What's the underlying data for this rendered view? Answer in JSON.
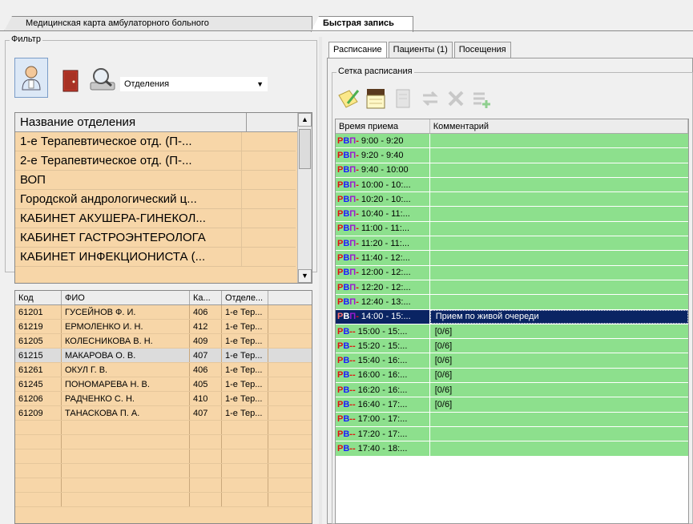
{
  "top_tabs": [
    {
      "label": "Медицинская карта амбулаторного больного"
    },
    {
      "label": "Быстрая запись"
    }
  ],
  "filter": {
    "title": "Фильтр",
    "select_value": "Отделения",
    "icons": [
      "doctor-icon",
      "door-icon",
      "magnifier-icon"
    ]
  },
  "departments": {
    "header": "Название отделения",
    "rows": [
      "1-е Терапевтическое отд. (П-...",
      "2-е Терапевтическое отд. (П-...",
      "ВОП",
      "Городской андрологический ц...",
      "КАБИНЕТ АКУШЕРА-ГИНЕКОЛ...",
      "КАБИНЕТ ГАСТРОЭНТЕРОЛОГА",
      "КАБИНЕТ ИНФЕКЦИОНИСТА (..."
    ]
  },
  "doctors": {
    "columns": [
      "Код",
      "ФИО",
      "Ка...",
      "Отделе..."
    ],
    "rows": [
      {
        "code": "61201",
        "name": "ГУСЕЙНОВ Ф. И.",
        "room": "406",
        "dept": "1-е Тер..."
      },
      {
        "code": "61219",
        "name": "ЕРМОЛЕНКО И. Н.",
        "room": "412",
        "dept": "1-е Тер..."
      },
      {
        "code": "61205",
        "name": "КОЛЕСНИКОВА В. Н.",
        "room": "409",
        "dept": "1-е Тер..."
      },
      {
        "code": "61215",
        "name": "МАКАРОВА О. В.",
        "room": "407",
        "dept": "1-е Тер..."
      },
      {
        "code": "61261",
        "name": "ОКУЛ Г. В.",
        "room": "406",
        "dept": "1-е Тер..."
      },
      {
        "code": "61245",
        "name": "ПОНОМАРЕВА Н. В.",
        "room": "405",
        "dept": "1-е Тер..."
      },
      {
        "code": "61206",
        "name": "РАДЧЕНКО С. Н.",
        "room": "410",
        "dept": "1-е Тер..."
      },
      {
        "code": "61209",
        "name": "ТАНАСКОВА П. А.",
        "room": "407",
        "dept": "1-е Тер..."
      }
    ]
  },
  "right_tabs": [
    "Расписание",
    "Пациенты (1)",
    "Посещения"
  ],
  "schedule": {
    "group_title": "Сетка расписания",
    "columns": [
      "Время приема",
      "Комментарий"
    ],
    "rows": [
      {
        "code": "РВП",
        "time": "9:00 - 9:20",
        "comment": ""
      },
      {
        "code": "РВП",
        "time": "9:20 - 9:40",
        "comment": ""
      },
      {
        "code": "РВП",
        "time": "9:40 - 10:00",
        "comment": ""
      },
      {
        "code": "РВП",
        "time": "10:00 - 10:...",
        "comment": ""
      },
      {
        "code": "РВП",
        "time": "10:20 - 10:...",
        "comment": ""
      },
      {
        "code": "РВП",
        "time": "10:40 - 11:...",
        "comment": ""
      },
      {
        "code": "РВП",
        "time": "11:00 - 11:...",
        "comment": ""
      },
      {
        "code": "РВП",
        "time": "11:20 - 11:...",
        "comment": ""
      },
      {
        "code": "РВП",
        "time": "11:40 - 12:...",
        "comment": ""
      },
      {
        "code": "РВП",
        "time": "12:00 - 12:...",
        "comment": ""
      },
      {
        "code": "РВП",
        "time": "12:20 - 12:...",
        "comment": ""
      },
      {
        "code": "РВП",
        "time": "12:40 - 13:...",
        "comment": ""
      },
      {
        "code": "РВП",
        "time": "14:00 - 15:...",
        "comment": "Прием по живой очереди",
        "selected": true
      },
      {
        "code": "РВ-",
        "time": "15:00 - 15:...",
        "comment": "[0/6]"
      },
      {
        "code": "РВ-",
        "time": "15:20 - 15:...",
        "comment": "[0/6]"
      },
      {
        "code": "РВ-",
        "time": "15:40 - 16:...",
        "comment": "[0/6]"
      },
      {
        "code": "РВ-",
        "time": "16:00 - 16:...",
        "comment": "[0/6]"
      },
      {
        "code": "РВ-",
        "time": "16:20 - 16:...",
        "comment": "[0/6]"
      },
      {
        "code": "РВ-",
        "time": "16:40 - 17:...",
        "comment": "[0/6]"
      },
      {
        "code": "РВ-",
        "time": "17:00 - 17:...",
        "comment": ""
      },
      {
        "code": "РВ-",
        "time": "17:20 - 17:...",
        "comment": ""
      },
      {
        "code": "РВ-",
        "time": "17:40 - 18:...",
        "comment": ""
      }
    ]
  },
  "colors": {
    "orange_row": "#f7d6a8",
    "green_slot": "#8de08d",
    "selected_slot": "#0a2463"
  }
}
